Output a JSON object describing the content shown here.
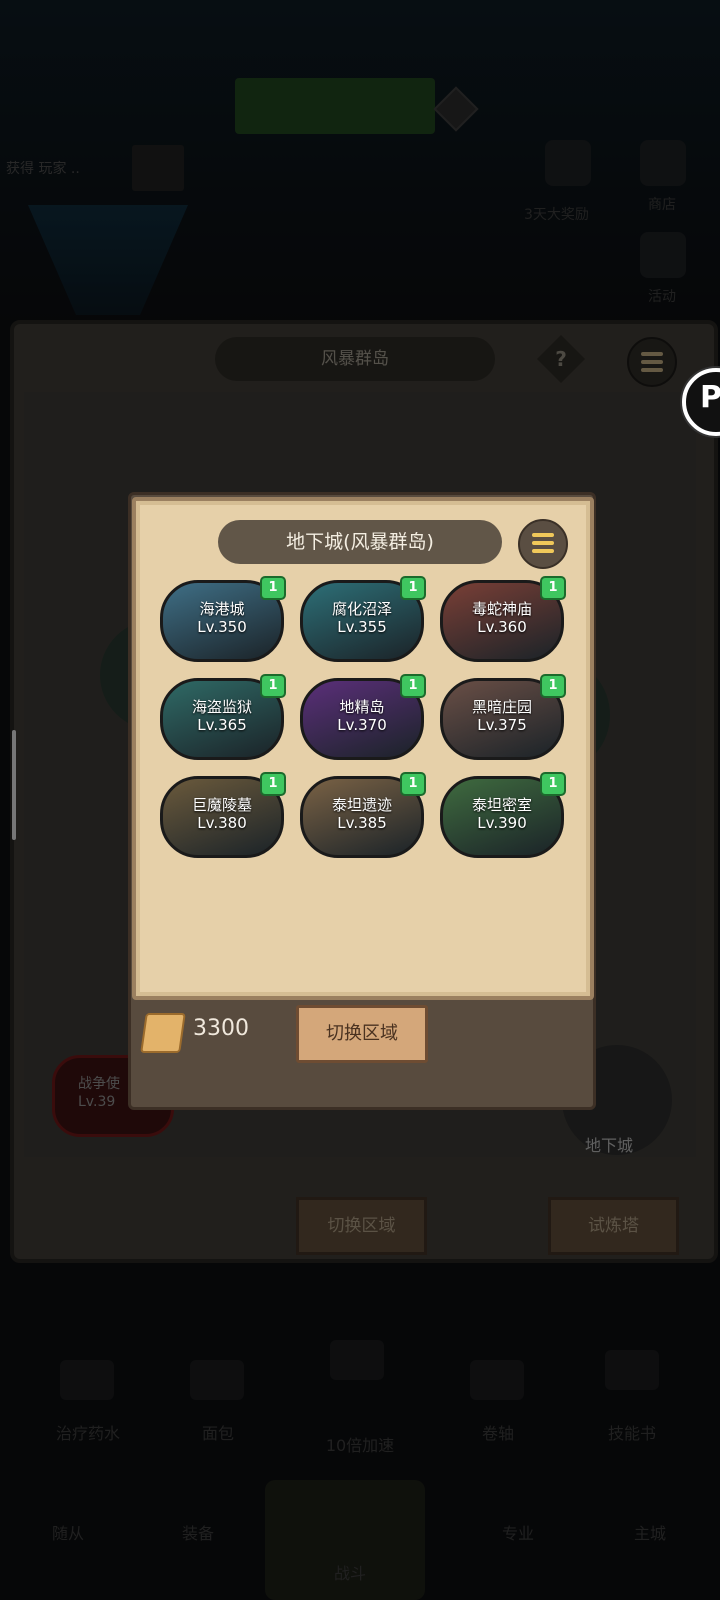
{
  "background": {
    "top_left_text": "获得 玩家 ..",
    "top_right_labels": [
      "3天大奖励",
      "商店",
      "活动"
    ],
    "region_title": "风暴群岛",
    "help_label": "?",
    "war_badge": {
      "name": "战争使",
      "level": "Lv.39"
    },
    "dungeon_label": "地下城",
    "buttons": {
      "switch_region": "切换区域",
      "trial_tower": "试炼塔"
    }
  },
  "bottom_nav": {
    "row1": [
      "治疗药水",
      "面包",
      "10倍加速",
      "卷轴",
      "技能书"
    ],
    "row2": [
      "随从",
      "装备",
      "战斗",
      "专业",
      "主城"
    ]
  },
  "float_button": {
    "letter": "P"
  },
  "modal": {
    "title": "地下城(风暴群岛)",
    "dungeons": [
      {
        "name": "海港城",
        "level": "Lv.350",
        "badge": "1",
        "color": "#3f6f86"
      },
      {
        "name": "腐化沼泽",
        "level": "Lv.355",
        "badge": "1",
        "color": "#2d6f77"
      },
      {
        "name": "毒蛇神庙",
        "level": "Lv.360",
        "badge": "1",
        "color": "#7a3f36"
      },
      {
        "name": "海盗监狱",
        "level": "Lv.365",
        "badge": "1",
        "color": "#2f6a66"
      },
      {
        "name": "地精岛",
        "level": "Lv.370",
        "badge": "1",
        "color": "#5b2f7a"
      },
      {
        "name": "黑暗庄园",
        "level": "Lv.375",
        "badge": "1",
        "color": "#6a4f46"
      },
      {
        "name": "巨魔陵墓",
        "level": "Lv.380",
        "badge": "1",
        "color": "#6b5a3c"
      },
      {
        "name": "泰坦遗迹",
        "level": "Lv.385",
        "badge": "1",
        "color": "#7a6245"
      },
      {
        "name": "泰坦密室",
        "level": "Lv.390",
        "badge": "1",
        "color": "#3f6b3f"
      }
    ],
    "cost": "3300",
    "switch_button": "切换区域"
  }
}
